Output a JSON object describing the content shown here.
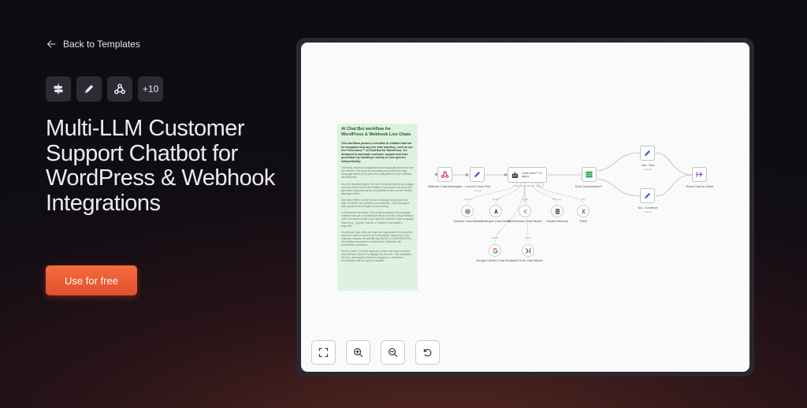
{
  "nav": {
    "back_label": "Back to Templates",
    "back_icon": "arrow-left-icon"
  },
  "icons": [
    {
      "name": "signpost-icon"
    },
    {
      "name": "pencil-icon"
    },
    {
      "name": "webhook-icon"
    },
    {
      "name": "more-count",
      "label": "+10"
    }
  ],
  "hero": {
    "title": "Multi-LLM Customer Support Chatbot for WordPress & Webhook Integrations"
  },
  "cta": {
    "label": "Use for free",
    "color": "#ef5f36"
  },
  "note": {
    "title": "AI Chat Bot workflow for WordPress & Webhook Live Chats",
    "intro": "This workflow powers a versatile AI chatbot that can be integrated into any live chat interface, such as our free Forerunner™ AI Chat Bot for WordPress. It's designed to automate customer support and lead generation by handling a variety of user queries independently.",
    "p1": "The setup process is straightforward and typically takes less than five minutes. This involves connecting your preferred Large Language Model (LLM) and a live chat platform to the workflow via webhooks.",
    "p2": "How the Workflow Works\nThe core of this workflow is an AI Agent that acts as the brain of the chatbot. It processes user input and generates responses based on predefined rules and the chosen language model.",
    "p3": "User Input: When a user sends a message through your live chat, it's sent to the workflow via a webhook. This message is then passed to the AI Agent for processing.",
    "p4": "AI Response Generation: The AI Agent analyzes the message, retrieves relevant conversational history from the Simple Memory node to maintain context, and uses the selected Large Language Model (e.g., OpenAI, Gemini, or Claude) to formulate a response.",
    "p5": "Conditional Logic: After the response is generated, the workflow uses an If node to check if the conversation should end. If the response contains the specific tag ENDLEX_CONVERSATION, the workflow proceeds to end the chat. Otherwise, the conversation continues.",
    "p6": "Send to Client: The final response is then sent back to the live chat interface, where it is displayed to the user. This completes the loop, allowing the chatbot to engage in a continuous conversation with the user is complete."
  },
  "workflow": {
    "nodes": {
      "website": "Website Chat Messages",
      "convert": "Convert Chat Text",
      "convert_sub": "manual",
      "agent": "Forerunner™ AI Agent",
      "end_conv": "End Conversation?",
      "yes_end": "Yes - End",
      "yes_end_sub": "manual",
      "no_continue": "No - Continue",
      "no_continue_sub": "manual",
      "send": "Send Chat to Client",
      "openai": "OpenAI Chat Model",
      "anthropic": "Anthropic Chat Model",
      "openrouter": "OpenRouter Chat Model",
      "memory": "Simple Memory",
      "think": "Think",
      "gemini": "Google Gemini Chat Model",
      "xai": "xAI Grok Chat Model"
    },
    "ports": {
      "chat_model": "Chat Model",
      "memory": "Memory",
      "tool": "Tool",
      "model": "Model",
      "agent_ports": "Chat Model · Memory · Tool"
    }
  },
  "controls": {
    "fit": "fit-view-icon",
    "zoom_in": "zoom-in-icon",
    "zoom_out": "zoom-out-icon",
    "reset": "reset-icon"
  }
}
